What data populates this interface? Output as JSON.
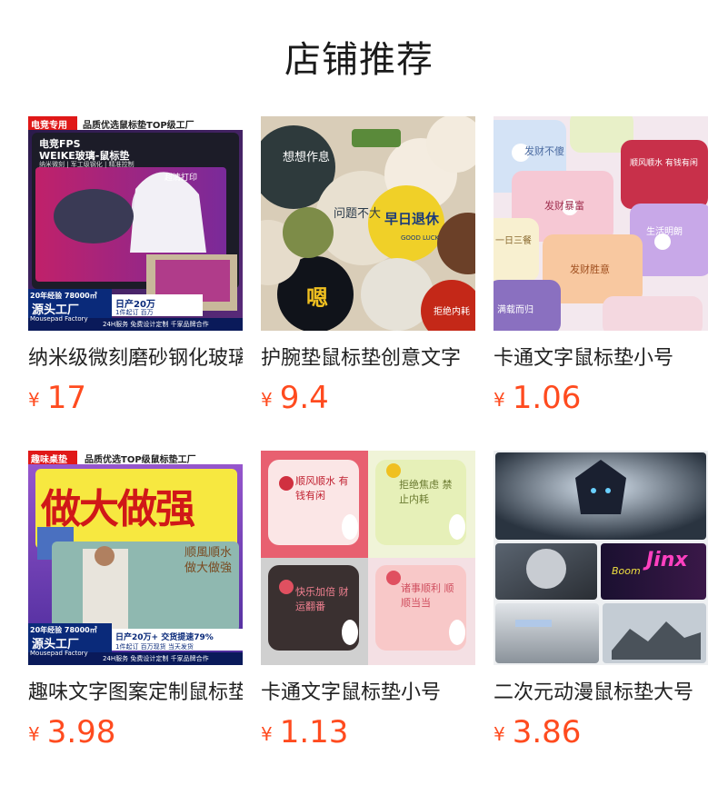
{
  "section_title": "店铺推荐",
  "currency_symbol": "¥",
  "products": [
    {
      "name": "纳米级微刻磨砂钢化玻璃鼠标垫",
      "price": "17",
      "image": {
        "top_tag": "电竞专用",
        "top_banner": "品质优选鼠标垫TOP级工厂",
        "headline_1": "电竞FPS",
        "headline_2": "WEIKE玻璃-鼠标垫",
        "features": "纳米微刻 | 军工级钢化 | 精准控制",
        "callout": "超清打印",
        "badge_years": "20年经验  78000㎡",
        "badge_factory": "源头工厂",
        "badge_en": "Mousepad Factory",
        "stat_daily": "日产20万",
        "stat_moq": "1件起订  百万",
        "footer": "24H服务  免费设计定制  千家品牌合作"
      }
    },
    {
      "name": "护腕垫鼠标垫创意文字",
      "price": "9.4",
      "image": {
        "text_1": "想想作息",
        "text_2": "问题不大",
        "text_3": "早日退休",
        "text_4": "嗯",
        "text_5": "GOOD LUCK",
        "text_6": "拒绝内耗"
      }
    },
    {
      "name": "卡通文字鼠标垫小号",
      "price": "1.06",
      "image": {
        "text_1": "发财不傻",
        "text_2": "顺风顺水 有钱有闲",
        "text_3": "发财暴富",
        "text_4": "一日三餐",
        "text_5": "生活明朗",
        "text_6": "发财胜意",
        "text_7": "满载而归"
      }
    },
    {
      "name": "趣味文字图案定制鼠标垫",
      "price": "3.98",
      "image": {
        "top_tag": "趣味桌垫",
        "top_banner": "品质优选TOP级鼠标垫工厂",
        "headline": "做大做强",
        "side_text": "顺風順水 做大做強",
        "badge_years": "20年经验  78000㎡",
        "badge_factory": "源头工厂",
        "badge_en": "Mousepad Factory",
        "stat_daily": "日产20万+  交货提速79%",
        "stat_moq": "1件起订  百万现货  当天发货",
        "footer": "24H服务  免费设计定制  千家品牌合作"
      }
    },
    {
      "name": "卡通文字鼠标垫小号",
      "price": "1.13",
      "image": {
        "text_1": "顺风顺水 有钱有闲",
        "text_2": "拒绝焦虑 禁止内耗",
        "text_3": "快乐加倍 财运翻番",
        "text_4": "诸事顺利 顺顺当当"
      }
    },
    {
      "name": "二次元动漫鼠标垫大号",
      "price": "3.86",
      "image": {
        "text_1": "Jinx",
        "text_2": "Boom"
      }
    }
  ],
  "colors": {
    "price": "#ff4b1f",
    "title": "#1a1a1a",
    "text": "#222222"
  }
}
